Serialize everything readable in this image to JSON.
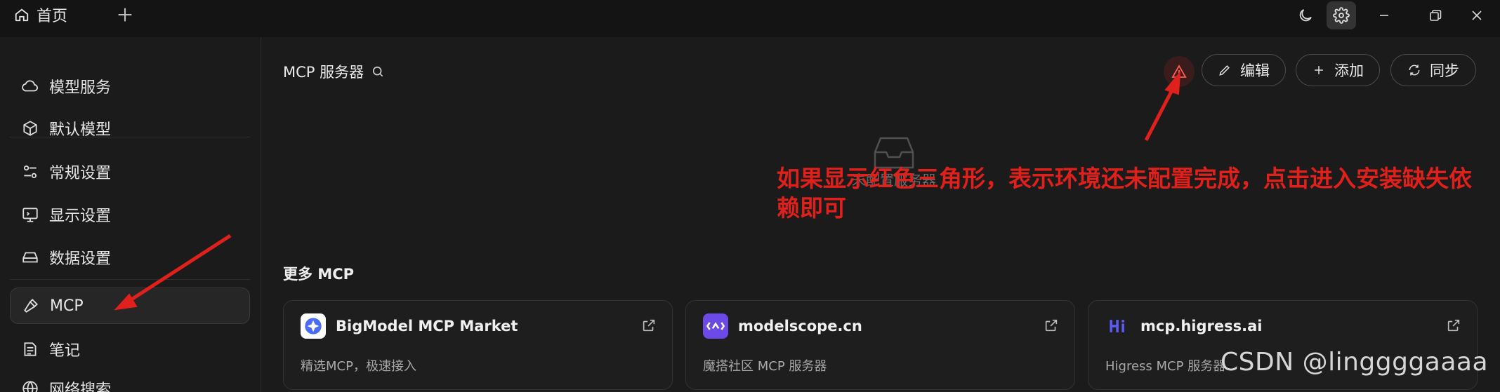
{
  "titlebar": {
    "tab_label": "首页"
  },
  "sidebar": {
    "items": [
      {
        "label": "模型服务",
        "icon": "cloud-icon"
      },
      {
        "label": "默认模型",
        "icon": "cube-icon"
      },
      {
        "label": "常规设置",
        "icon": "sliders-icon"
      },
      {
        "label": "显示设置",
        "icon": "monitor-icon"
      },
      {
        "label": "数据设置",
        "icon": "drive-icon"
      },
      {
        "label": "MCP",
        "icon": "hammer-icon",
        "active": true
      },
      {
        "label": "笔记",
        "icon": "note-icon"
      },
      {
        "label": "网络搜索",
        "icon": "globe-icon"
      }
    ]
  },
  "main": {
    "title": "MCP 服务器",
    "buttons": {
      "edit": "编辑",
      "add": "添加",
      "sync": "同步"
    },
    "empty_label": "未配置服务器",
    "more_title": "更多 MCP",
    "cards": [
      {
        "name": "BigModel MCP Market",
        "desc": "精选MCP，极速接入",
        "icon": "bigmodel-logo"
      },
      {
        "name": "modelscope.cn",
        "desc": "魔搭社区 MCP 服务器",
        "icon": "modelscope-logo"
      },
      {
        "name": "mcp.higress.ai",
        "desc": "Higress MCP 服务器",
        "icon": "higress-logo"
      }
    ]
  },
  "annotation": {
    "note": "如果显示红色三角形，表示环境还未配置完成，点击进入安装缺失依赖即可",
    "color": "#e0201b"
  },
  "watermark": "CSDN @linggggaaaa",
  "colors": {
    "background": "#1b1b1b",
    "titlebar": "#141414",
    "warning": "#e0201b"
  }
}
